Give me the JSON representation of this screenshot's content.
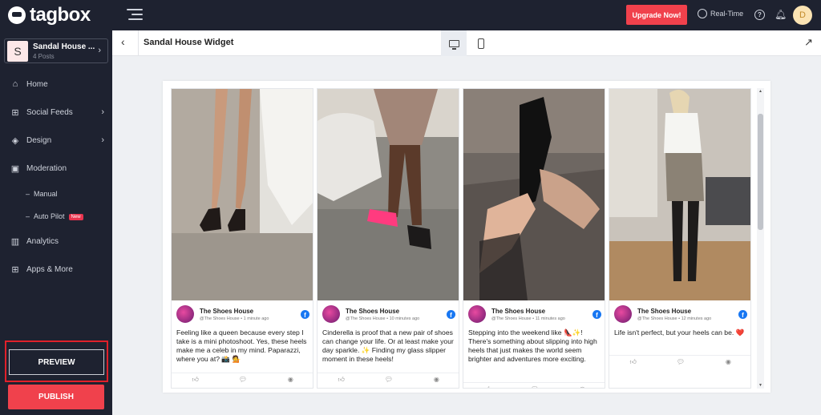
{
  "brand": {
    "logo_text": "tagbox"
  },
  "workspace": {
    "avatar_letter": "S",
    "name": "Sandal House ...",
    "posts": "4 Posts"
  },
  "nav": {
    "home": "Home",
    "social_feeds": "Social Feeds",
    "design": "Design",
    "moderation": "Moderation",
    "manual": "Manual",
    "auto_pilot": "Auto Pilot",
    "new_badge": "New",
    "analytics": "Analytics",
    "apps_more": "Apps & More"
  },
  "actions": {
    "preview": "PREVIEW",
    "publish": "PUBLISH"
  },
  "topbar": {
    "upgrade": "Upgrade Now!",
    "realtime": "Real-Time",
    "user_initial": "D"
  },
  "subbar": {
    "title": "Sandal House Widget"
  },
  "colors": {
    "accent": "#f0414c",
    "sidebar": "#1e2230",
    "facebook": "#1877f2"
  },
  "posts": [
    {
      "author": "The Shoes House",
      "handle": "@The Shoes House",
      "time": "1 minute ago",
      "text": "Feeling like a queen because every step I take is a mini photoshoot. Yes, these heels make me a celeb in my mind. Paparazzi, where you at? 📸 💁"
    },
    {
      "author": "The Shoes House",
      "handle": "@The Shoes House",
      "time": "10 minutes ago",
      "text": "Cinderella is proof that a new pair of shoes can change your life. Or at least make your day sparkle. ✨ Finding my glass slipper moment in these heels!"
    },
    {
      "author": "The Shoes House",
      "handle": "@The Shoes House",
      "time": "11 minutes ago",
      "text": "Stepping into the weekend like 👠✨! There's something about slipping into high heels that just makes the world seem brighter and adventures more exciting."
    },
    {
      "author": "The Shoes House",
      "handle": "@The Shoes House",
      "time": "12 minutes ago",
      "text": "Life isn't perfect, but your heels can be. ❤️"
    }
  ]
}
